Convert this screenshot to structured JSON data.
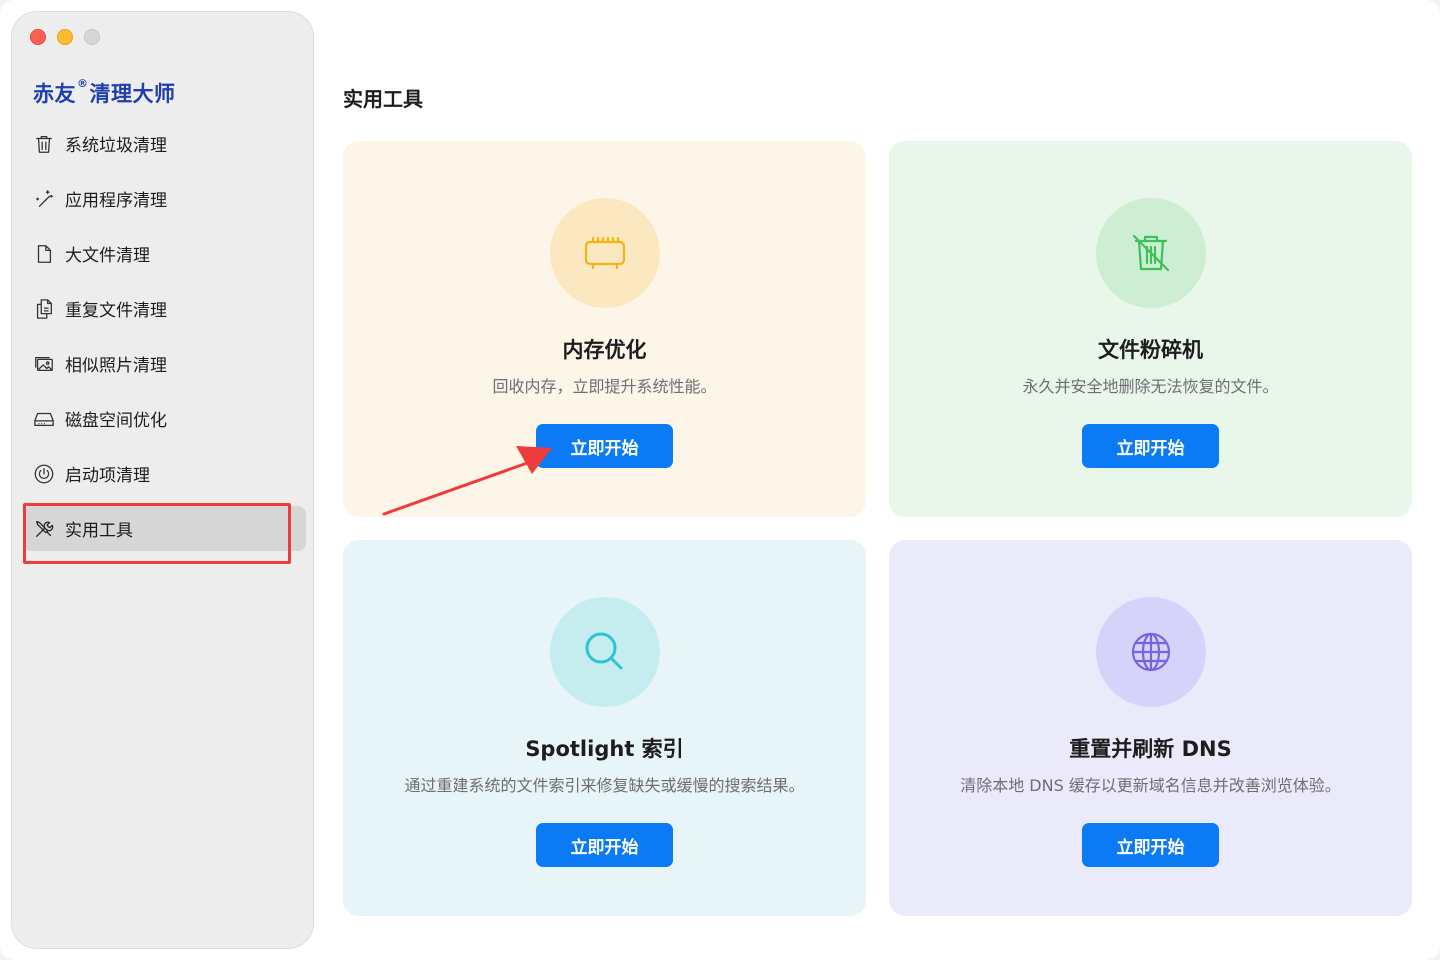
{
  "window": {
    "brand": {
      "name_part1": "赤友",
      "reg_mark": "®",
      "name_part2": "清理大师"
    }
  },
  "sidebar": {
    "items": [
      {
        "label": "系统垃圾清理",
        "icon": "trash-icon",
        "active": false
      },
      {
        "label": "应用程序清理",
        "icon": "magic-wand-icon",
        "active": false
      },
      {
        "label": "大文件清理",
        "icon": "document-icon",
        "active": false
      },
      {
        "label": "重复文件清理",
        "icon": "duplicate-files-icon",
        "active": false
      },
      {
        "label": "相似照片清理",
        "icon": "photos-icon",
        "active": false
      },
      {
        "label": "磁盘空间优化",
        "icon": "disk-icon",
        "active": false
      },
      {
        "label": "启动项清理",
        "icon": "power-icon",
        "active": false
      },
      {
        "label": "实用工具",
        "icon": "tools-icon",
        "active": true
      }
    ]
  },
  "main": {
    "title": "实用工具",
    "cards": [
      {
        "title": "内存优化",
        "desc": "回收内存，立即提升系统性能。",
        "button": "立即开始",
        "icon": "memory-chip-icon",
        "bg": "#fdf6e8",
        "icon_bg": "#fbe8c0",
        "icon_color": "#f3b316"
      },
      {
        "title": "文件粉碎机",
        "desc": "永久并安全地删除无法恢复的文件。",
        "button": "立即开始",
        "icon": "shredder-trash-icon",
        "bg": "#e9f6ea",
        "icon_bg": "#cdeed2",
        "icon_color": "#3cc15a"
      },
      {
        "title": "Spotlight 索引",
        "desc": "通过重建系统的文件索引来修复缺失或缓慢的搜索结果。",
        "button": "立即开始",
        "icon": "magnifier-icon",
        "bg": "#e7f5f8",
        "icon_bg": "#c5ecef",
        "icon_color": "#2fc4cf"
      },
      {
        "title": "重置并刷新 DNS",
        "desc": "清除本地 DNS 缓存以更新域名信息并改善浏览体验。",
        "button": "立即开始",
        "icon": "globe-icon",
        "bg": "#ebeafb",
        "icon_bg": "#d6d3fb",
        "icon_color": "#7864e3"
      }
    ]
  },
  "colors": {
    "accent": "#0a7af5",
    "annotation": "#ee3b3b",
    "brand": "#1f3fb0"
  }
}
